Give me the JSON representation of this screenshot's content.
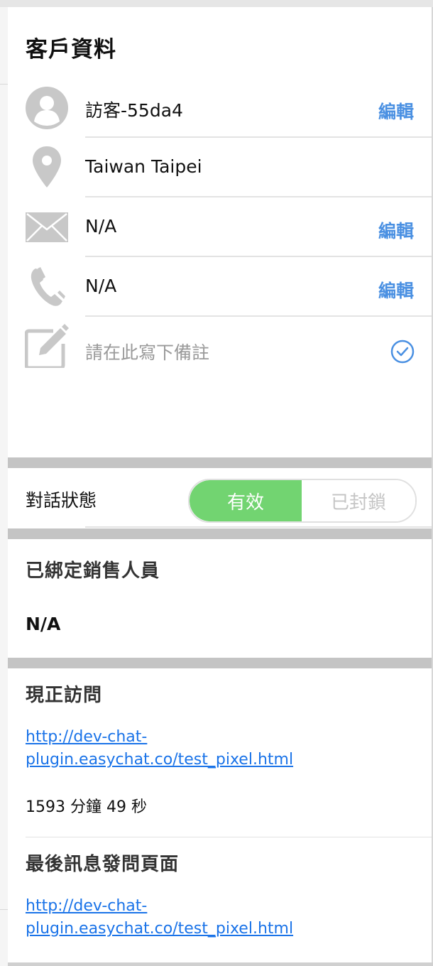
{
  "title": "客戶資料",
  "rows": [
    {
      "icon": "user-avatar-icon",
      "value": "訪客-55da4",
      "edit": "編輯"
    },
    {
      "icon": "location-pin-icon",
      "value": "Taiwan Taipei"
    },
    {
      "icon": "email-envelope-icon",
      "value": "N/A",
      "edit": "編輯"
    },
    {
      "icon": "phone-icon",
      "value": "N/A",
      "edit": "編輯"
    },
    {
      "icon": "edit-note-icon",
      "placeholder": "請在此寫下備註",
      "confirm_icon": "check-circle-icon"
    }
  ],
  "status": {
    "label": "對話狀態",
    "active_label": "有效",
    "blocked_label": "已封鎖",
    "selected": "有效"
  },
  "sales": {
    "title": "已綁定銷售人員",
    "value": "N/A"
  },
  "current_visit": {
    "title": "現正訪問",
    "url": "http://dev-chat-plugin.easychat.co/test_pixel.html",
    "url_line1": "http://dev-chat-",
    "url_line2": "plugin.easychat.co/test_pixel.html",
    "duration": "1593 分鐘 49 秒"
  },
  "last_message_page": {
    "title": "最後訊息發問頁面",
    "url": "http://dev-chat-plugin.easychat.co/test_pixel.html",
    "url_line1": "http://dev-chat-",
    "url_line2": "plugin.easychat.co/test_pixel.html"
  },
  "colors": {
    "accent": "#4a90e2",
    "toggle_active": "#72d471",
    "link": "#1a73e8",
    "icon_gray": "#c8c8c8"
  }
}
